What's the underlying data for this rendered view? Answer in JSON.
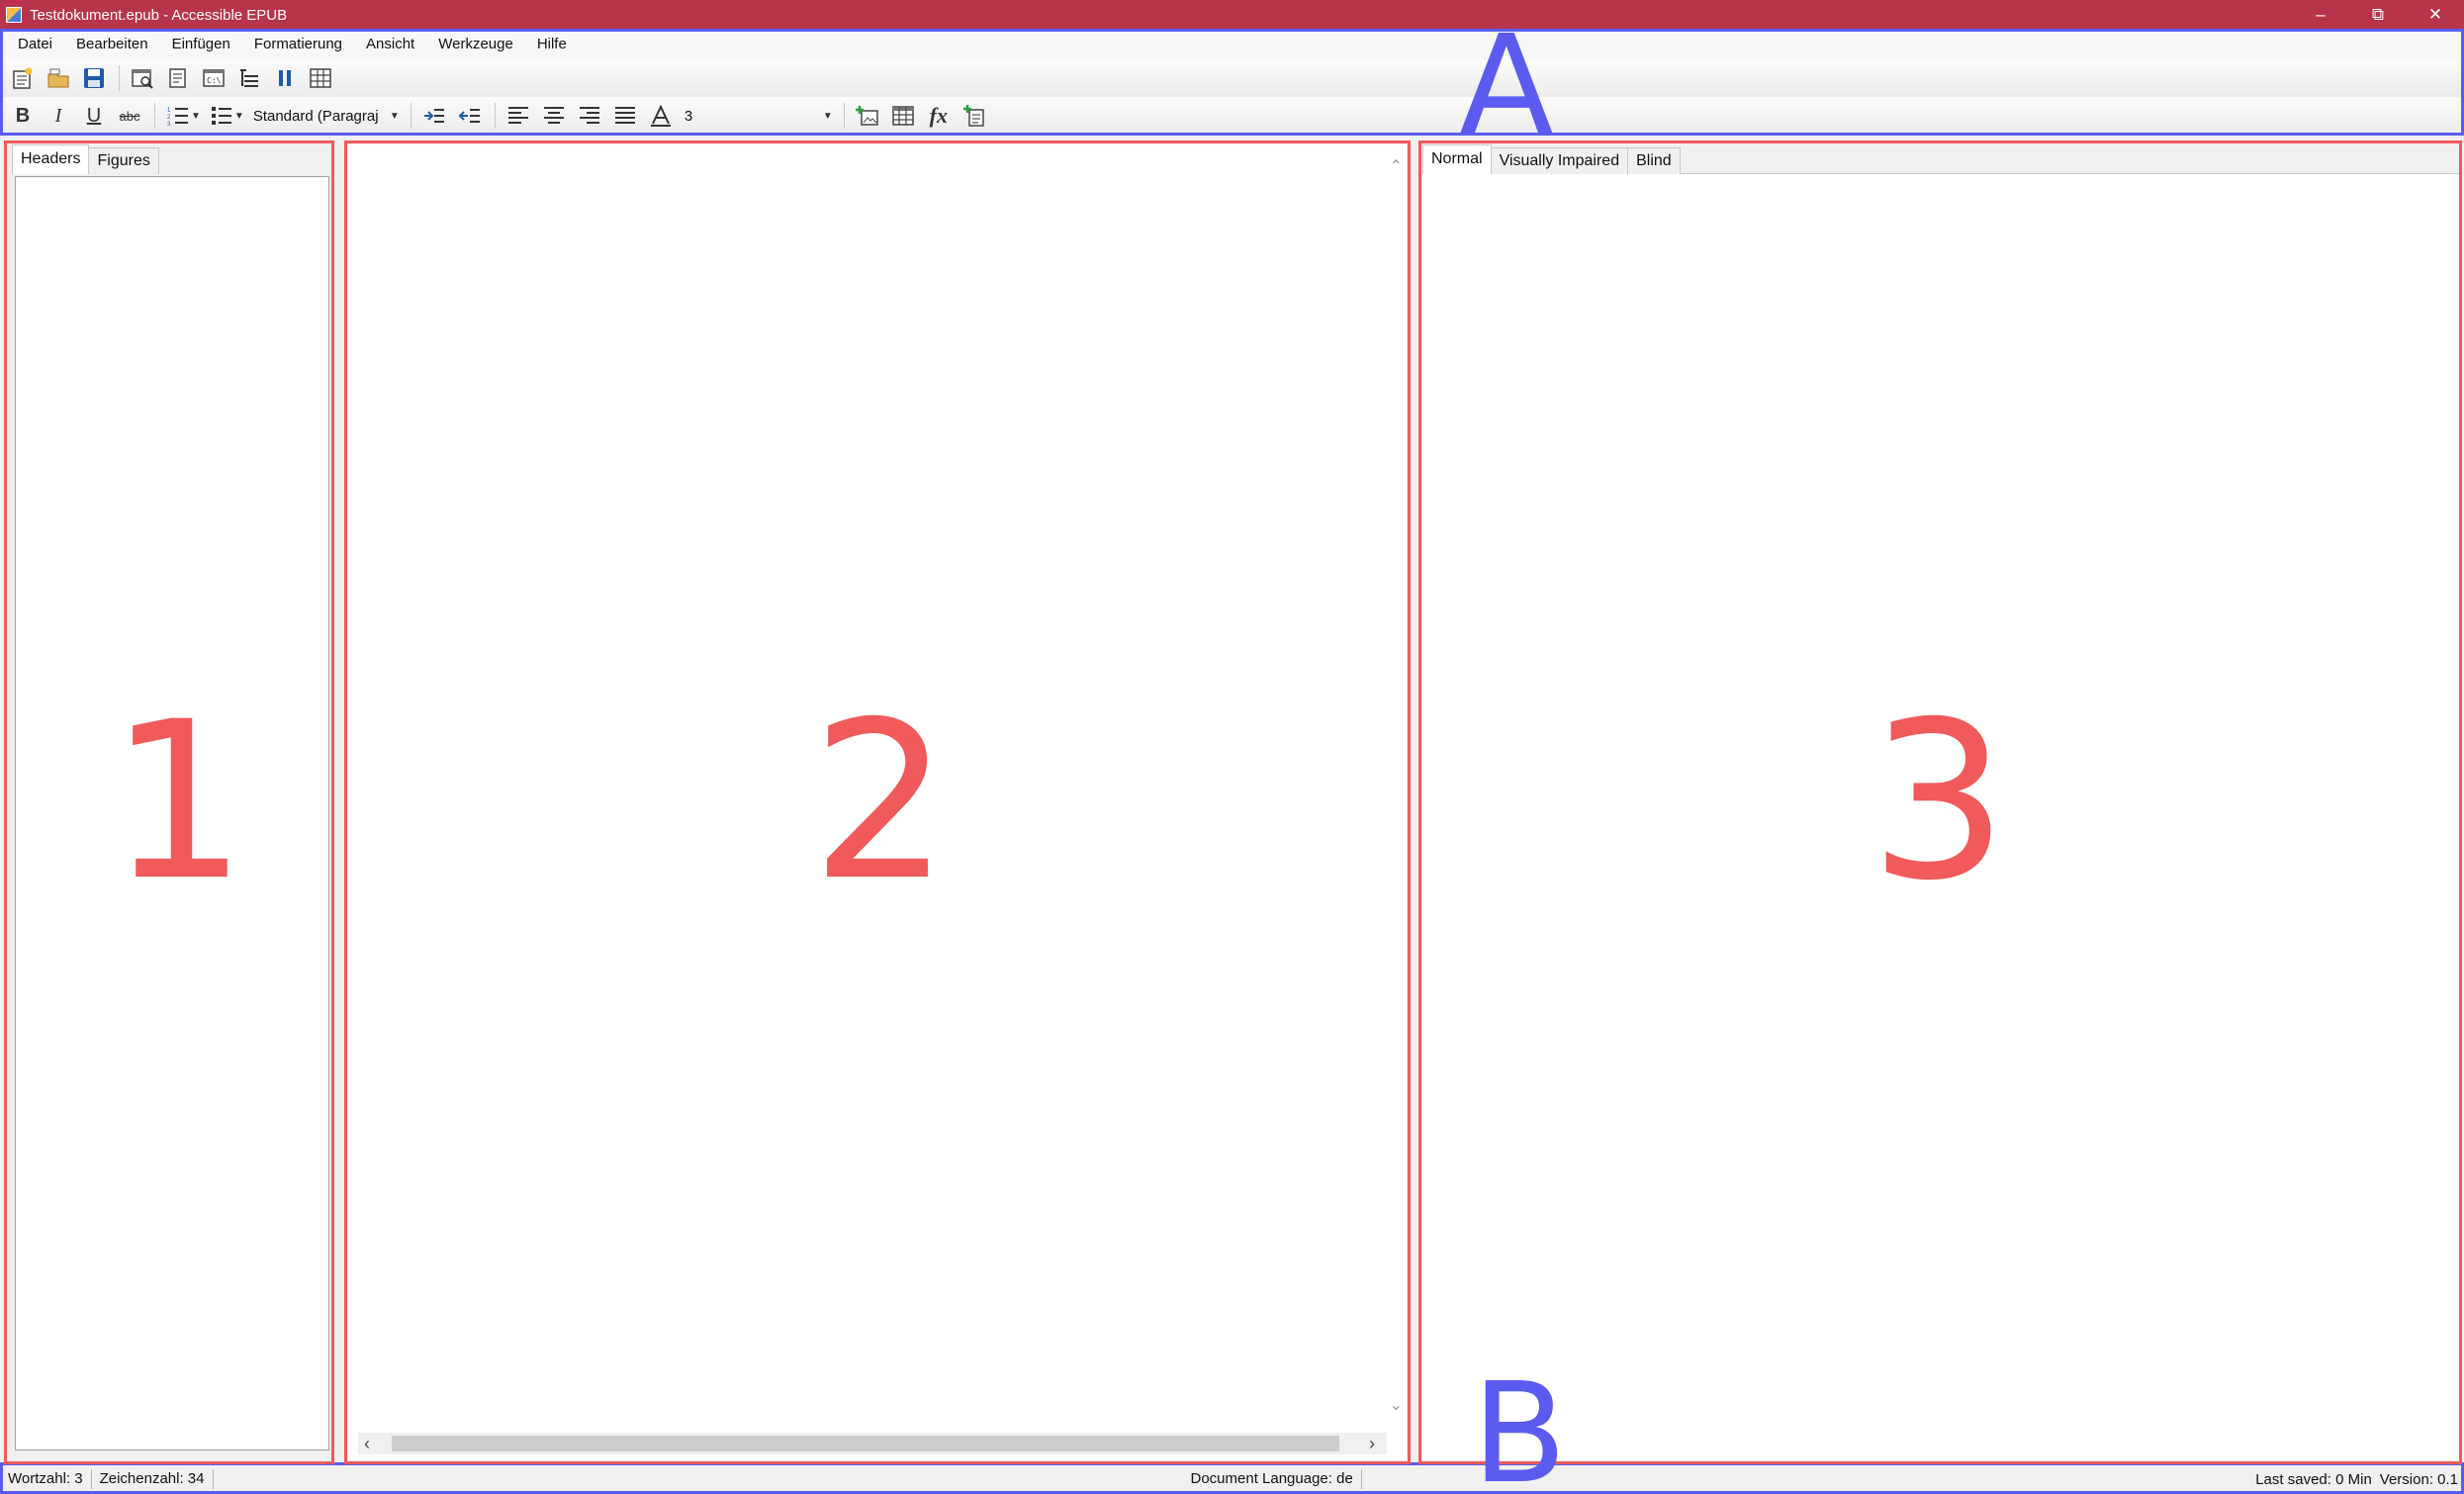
{
  "window": {
    "title": "Testdokument.epub - Accessible EPUB",
    "controls": {
      "minimize": "–",
      "restore": "⧉",
      "close": "✕"
    }
  },
  "menu": [
    "Datei",
    "Bearbeiten",
    "Einfügen",
    "Formatierung",
    "Ansicht",
    "Werkzeuge",
    "Hilfe"
  ],
  "toolbar2": {
    "bold": "B",
    "italic": "I",
    "underline": "U",
    "strikethrough": "abc",
    "style_value": "Standard (Paragraph)",
    "style_display": "Standard (Paragraj",
    "font_size_value": "3",
    "fx_label": "fx"
  },
  "left_panel": {
    "tabs": [
      "Headers",
      "Figures"
    ],
    "active_tab": "Headers"
  },
  "right_panel": {
    "tabs": [
      "Normal",
      "Visually Impaired",
      "Blind"
    ],
    "active_tab": "Normal"
  },
  "annotations": {
    "top_region": "A",
    "bottom_region": "B",
    "left_region": "1",
    "center_region": "2",
    "right_region": "3"
  },
  "status": {
    "word_count": "Wortzahl: 3",
    "char_count": "Zeichenzahl: 34",
    "language": "Document Language: de",
    "last_saved": "Last saved: 0 Min",
    "version": "Version: 0.1"
  },
  "colors": {
    "titlebar": "#b8344a",
    "annotation_blue": "#5b5bf0",
    "annotation_red": "#f05a5a"
  }
}
